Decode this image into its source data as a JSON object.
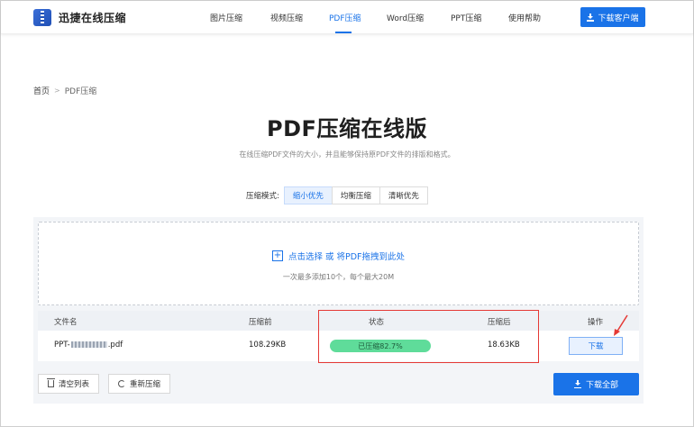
{
  "header": {
    "logo_text": "迅捷在线压缩",
    "nav": [
      {
        "label": "图片压缩",
        "active": false
      },
      {
        "label": "视频压缩",
        "active": false
      },
      {
        "label": "PDF压缩",
        "active": true
      },
      {
        "label": "Word压缩",
        "active": false
      },
      {
        "label": "PPT压缩",
        "active": false
      },
      {
        "label": "使用帮助",
        "active": false
      }
    ],
    "client_button": "下载客户端"
  },
  "breadcrumb": {
    "home": "首页",
    "sep": ">",
    "current": "PDF压缩"
  },
  "title": "PDF压缩在线版",
  "subtitle": "在线压缩PDF文件的大小，并且能够保持原PDF文件的排版和格式。",
  "mode": {
    "label": "压缩模式:",
    "options": [
      "缩小优先",
      "均衡压缩",
      "清晰优先"
    ],
    "selected": "缩小优先"
  },
  "upload": {
    "plus": "+",
    "text": "点击选择 或 将PDF拖拽到此处",
    "hint": "一次最多添加10个，每个最大20M"
  },
  "table": {
    "headers": {
      "name": "文件名",
      "before": "压缩前",
      "status": "状态",
      "after": "压缩后",
      "action": "操作"
    },
    "rows": [
      {
        "name_prefix": "PPT-",
        "name_suffix": ".pdf",
        "before": "108.29KB",
        "status": "已压缩82.7%",
        "after": "18.63KB",
        "action": "下载"
      }
    ]
  },
  "footer": {
    "clear": "清空列表",
    "recompress": "重新压缩",
    "download_all": "下载全部"
  },
  "colors": {
    "accent": "#1a73e8",
    "success": "#5fdc9a",
    "highlight": "#e53935"
  }
}
